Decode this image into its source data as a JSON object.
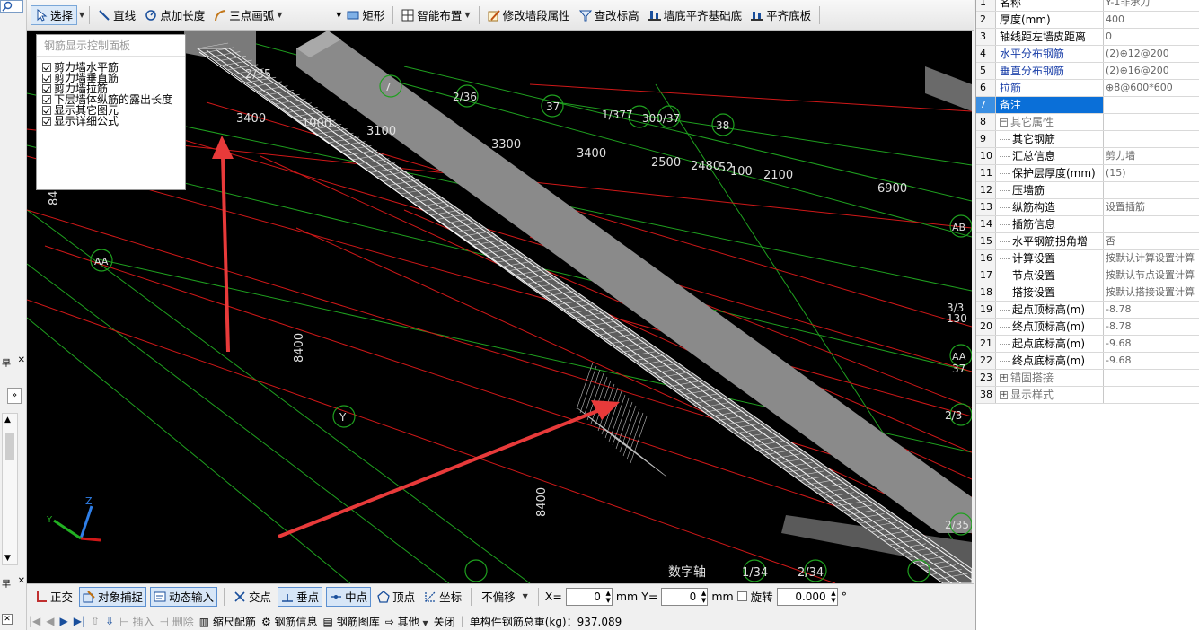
{
  "toolbar": {
    "select": "选择",
    "line": "直线",
    "point_length": "点加长度",
    "three_point_arc": "三点画弧",
    "rect": "矩形",
    "smart_layout": "智能布置",
    "modify_wall_segment": "修改墙段属性",
    "check_elevation": "查改标高",
    "wall_bottom_align": "墙底平齐基础底",
    "align_bottom": "平齐底板"
  },
  "rebar_panel": {
    "title": "钢筋显示控制面板",
    "options": [
      {
        "label": "剪力墙水平筋",
        "checked": true
      },
      {
        "label": "剪力墙垂直筋",
        "checked": true
      },
      {
        "label": "剪力墙拉筋",
        "checked": true
      },
      {
        "label": "下层墙体纵筋的露出长度",
        "checked": true
      },
      {
        "label": "显示其它图元",
        "checked": true
      },
      {
        "label": "显示详细公式",
        "checked": true
      }
    ]
  },
  "canvas_labels": {
    "dims": [
      "2/35",
      "3400",
      "1900",
      "3100",
      "3300",
      "3400",
      "2500",
      "2480",
      "52",
      "100",
      "2100",
      "6900",
      "8400",
      "8400",
      "84"
    ],
    "axes": [
      "AA",
      "Y",
      "37",
      "38",
      "2/36",
      "1/37",
      "7",
      "1/377",
      "300/37",
      "AB",
      "3/3",
      "130",
      "AA",
      "37",
      "2/3",
      "2/35"
    ],
    "bottom_labels": [
      "数字轴",
      "1/34",
      "2/34"
    ]
  },
  "props": {
    "rows": [
      {
        "num": "1",
        "name": "名称",
        "value": "Y-1非承力",
        "style": "normal"
      },
      {
        "num": "2",
        "name": "厚度(mm)",
        "value": "400",
        "style": "normal"
      },
      {
        "num": "3",
        "name": "轴线距左墙皮距离",
        "value": "0",
        "style": "normal"
      },
      {
        "num": "4",
        "name": "水平分布钢筋",
        "value": "(2)⊕12@200",
        "style": "blue"
      },
      {
        "num": "5",
        "name": "垂直分布钢筋",
        "value": "(2)⊕16@200",
        "style": "blue"
      },
      {
        "num": "6",
        "name": "拉筋",
        "value": "⊕8@600*600",
        "style": "blue"
      },
      {
        "num": "7",
        "name": "备注",
        "value": "",
        "style": "selected"
      },
      {
        "num": "8",
        "name": "其它属性",
        "value": "",
        "style": "group"
      },
      {
        "num": "9",
        "name": "其它钢筋",
        "value": "",
        "style": "child"
      },
      {
        "num": "10",
        "name": "汇总信息",
        "value": "剪力墙",
        "style": "child"
      },
      {
        "num": "11",
        "name": "保护层厚度(mm)",
        "value": "(15)",
        "style": "child"
      },
      {
        "num": "12",
        "name": "压墙筋",
        "value": "",
        "style": "child"
      },
      {
        "num": "13",
        "name": "纵筋构造",
        "value": "设置插筋",
        "style": "child"
      },
      {
        "num": "14",
        "name": "插筋信息",
        "value": "",
        "style": "child"
      },
      {
        "num": "15",
        "name": "水平钢筋拐角增",
        "value": "否",
        "style": "child"
      },
      {
        "num": "16",
        "name": "计算设置",
        "value": "按默认计算设置计算",
        "style": "child"
      },
      {
        "num": "17",
        "name": "节点设置",
        "value": "按默认节点设置计算",
        "style": "child"
      },
      {
        "num": "18",
        "name": "搭接设置",
        "value": "按默认搭接设置计算",
        "style": "child"
      },
      {
        "num": "19",
        "name": "起点顶标高(m)",
        "value": "-8.78",
        "style": "child"
      },
      {
        "num": "20",
        "name": "终点顶标高(m)",
        "value": "-8.78",
        "style": "child"
      },
      {
        "num": "21",
        "name": "起点底标高(m)",
        "value": "-9.68",
        "style": "child"
      },
      {
        "num": "22",
        "name": "终点底标高(m)",
        "value": "-9.68",
        "style": "child"
      },
      {
        "num": "23",
        "name": "锚固搭接",
        "value": "",
        "style": "groupplus"
      },
      {
        "num": "38",
        "name": "显示样式",
        "value": "",
        "style": "groupplus"
      }
    ]
  },
  "status1": {
    "ortho": "正交",
    "snap": "对象捕捉",
    "dynamic_input": "动态输入",
    "intersection": "交点",
    "perpendicular": "垂点",
    "midpoint": "中点",
    "vertex": "顶点",
    "coord": "坐标",
    "offset_mode": "不偏移",
    "x_label": "X=",
    "x_value": "0",
    "y_label": "Y=",
    "y_value": "0",
    "unit": "mm",
    "rotate": "旋转",
    "rotate_value": "0.000",
    "degree": "°"
  },
  "status2": {
    "insert": "插入",
    "delete": "删除",
    "scale_rebar": "缩尺配筋",
    "rebar_info": "钢筋信息",
    "rebar_library": "钢筋图库",
    "other": "其他",
    "close": "关闭",
    "total_weight": "单构件钢筋总重(kg)：937.089"
  },
  "colors": {
    "canvas_bg": "#000000",
    "red_line": "#d01818",
    "green_line": "#1fa01f",
    "arrow": "#e83a3a",
    "selected_row": "#0a6fd8"
  }
}
